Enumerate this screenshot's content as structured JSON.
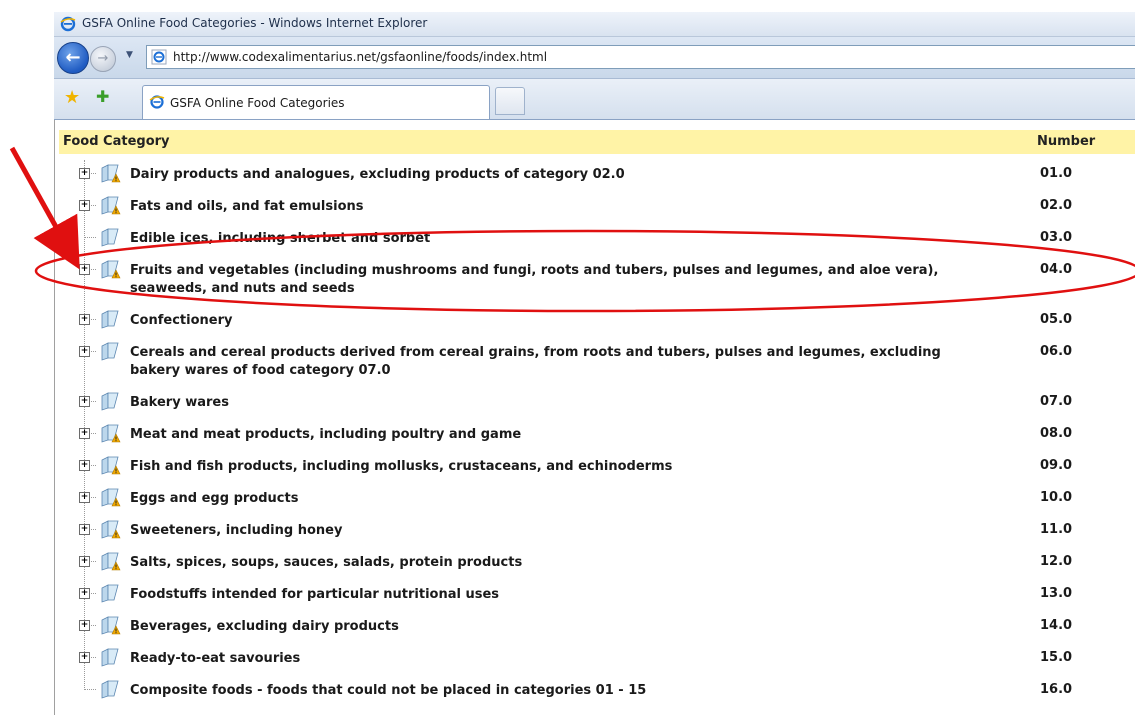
{
  "window": {
    "title": "GSFA Online Food Categories - Windows Internet Explorer"
  },
  "address_bar": {
    "url": "http://www.codexalimentarius.net/gsfaonline/foods/index.html"
  },
  "tabs": [
    {
      "label": "GSFA Online Food Categories",
      "active": true
    }
  ],
  "table": {
    "header_category": "Food Category",
    "header_number": "Number",
    "rows": [
      {
        "label": "Dairy products and analogues, excluding products of category 02.0",
        "number": "01.0",
        "expandable": true,
        "warning": true
      },
      {
        "label": "Fats and oils, and fat emulsions",
        "number": "02.0",
        "expandable": true,
        "warning": true
      },
      {
        "label": "Edible ices, including sherbet and sorbet",
        "number": "03.0",
        "expandable": false,
        "warning": false
      },
      {
        "label": "Fruits and vegetables (including mushrooms and fungi, roots and tubers, pulses and legumes, and aloe vera), seaweeds, and nuts and seeds",
        "number": "04.0",
        "expandable": true,
        "warning": true,
        "highlighted": true
      },
      {
        "label": "Confectionery",
        "number": "05.0",
        "expandable": true,
        "warning": false
      },
      {
        "label": "Cereals and cereal products derived from cereal grains, from roots and tubers, pulses and legumes, excluding bakery wares of food category 07.0",
        "number": "06.0",
        "expandable": true,
        "warning": false
      },
      {
        "label": "Bakery wares",
        "number": "07.0",
        "expandable": true,
        "warning": false
      },
      {
        "label": "Meat and meat products, including poultry and game",
        "number": "08.0",
        "expandable": true,
        "warning": true
      },
      {
        "label": "Fish and fish products, including mollusks, crustaceans, and echinoderms",
        "number": "09.0",
        "expandable": true,
        "warning": true
      },
      {
        "label": "Eggs and egg products",
        "number": "10.0",
        "expandable": true,
        "warning": true
      },
      {
        "label": "Sweeteners, including honey",
        "number": "11.0",
        "expandable": true,
        "warning": true
      },
      {
        "label": "Salts, spices, soups, sauces, salads, protein products",
        "number": "12.0",
        "expandable": true,
        "warning": true
      },
      {
        "label": "Foodstuffs intended for particular nutritional uses",
        "number": "13.0",
        "expandable": true,
        "warning": false
      },
      {
        "label": "Beverages, excluding dairy products",
        "number": "14.0",
        "expandable": true,
        "warning": true
      },
      {
        "label": "Ready-to-eat savouries",
        "number": "15.0",
        "expandable": true,
        "warning": false
      },
      {
        "label": "Composite foods - foods that could not be placed in categories 01 - 15",
        "number": "16.0",
        "expandable": false,
        "warning": false
      }
    ]
  },
  "colors": {
    "header_bg": "#fff3a6",
    "annotation_red": "#e01010",
    "warning_badge": "#f2a900"
  },
  "icons": {
    "expander": "plus-box-icon",
    "folder": "folder-icon",
    "warning": "warning-icon"
  }
}
